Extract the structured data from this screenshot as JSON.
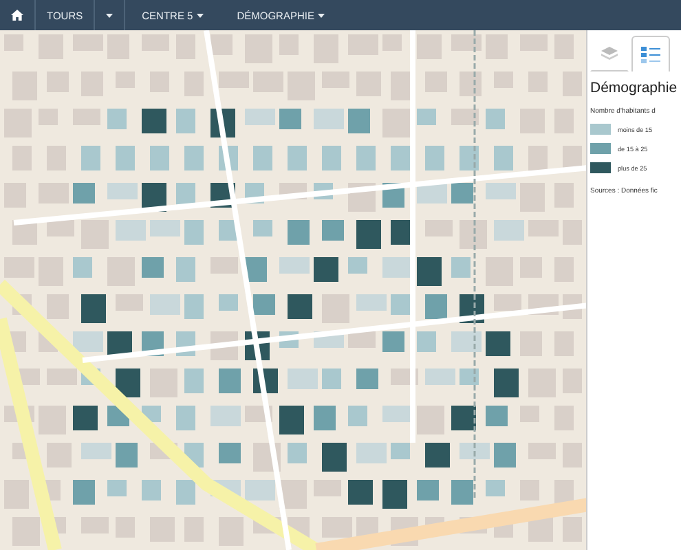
{
  "navbar": {
    "items": [
      {
        "kind": "home"
      },
      {
        "kind": "link",
        "label": "TOURS"
      },
      {
        "kind": "split-caret"
      },
      {
        "kind": "dropdown",
        "label": "CENTRE 5"
      },
      {
        "kind": "dropdown",
        "label": "DÉMOGRAPHIE"
      }
    ]
  },
  "panel": {
    "tabs": [
      {
        "kind": "layers",
        "selected": false
      },
      {
        "kind": "legend",
        "selected": true
      }
    ],
    "title": "Démographie",
    "legend_title": "Nombre d'habitants d",
    "legend": [
      {
        "label": "moins de 15",
        "color": "#a9c8ce"
      },
      {
        "label": "de 15 à 25",
        "color": "#6fa1aa"
      },
      {
        "label": "plus de 25",
        "color": "#2f585e"
      }
    ],
    "sources": "Sources : Données fic"
  }
}
